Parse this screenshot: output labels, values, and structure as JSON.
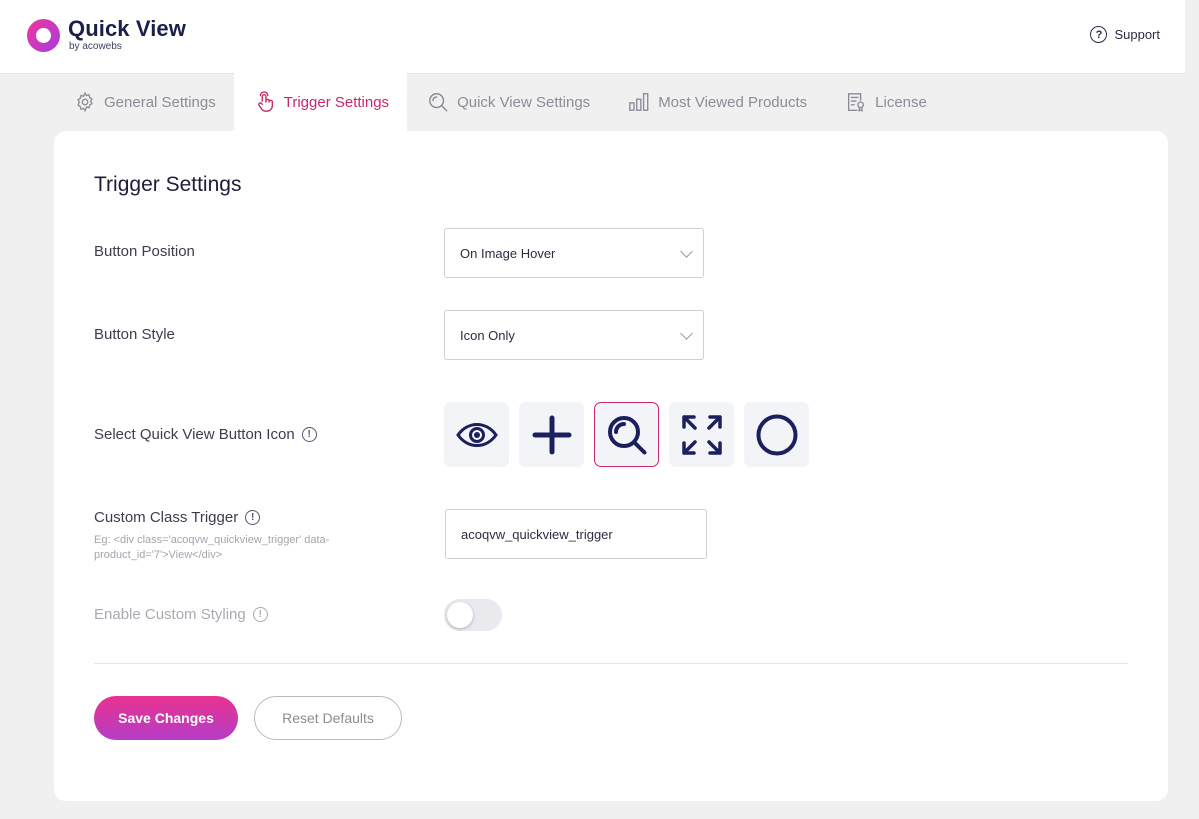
{
  "header": {
    "logo_title": "Quick View",
    "logo_sub": "by acowebs",
    "support_label": "Support"
  },
  "tabs": [
    {
      "label": "General Settings",
      "icon": "gear-icon",
      "active": false
    },
    {
      "label": "Trigger Settings",
      "icon": "touch-hand-icon",
      "active": true
    },
    {
      "label": "Quick View Settings",
      "icon": "magnify-icon",
      "active": false
    },
    {
      "label": "Most Viewed Products",
      "icon": "bar-chart-icon",
      "active": false
    },
    {
      "label": "License",
      "icon": "certificate-icon",
      "active": false
    }
  ],
  "panel": {
    "title": "Trigger Settings",
    "button_position": {
      "label": "Button Position",
      "value": "On Image Hover"
    },
    "button_style": {
      "label": "Button Style",
      "value": "Icon Only"
    },
    "icon_select": {
      "label": "Select Quick View Button Icon",
      "options": [
        "eye-icon",
        "plus-icon",
        "magnify-icon",
        "expand-arrows-icon",
        "circle-icon"
      ],
      "selected": "magnify-icon"
    },
    "custom_class": {
      "label": "Custom Class Trigger",
      "hint": "Eg: <div class='acoqvw_quickview_trigger' data-product_id='7'>View</div>",
      "value": "acoqvw_quickview_trigger"
    },
    "custom_styling": {
      "label": "Enable Custom Styling",
      "enabled": false
    },
    "save_label": "Save Changes",
    "reset_label": "Reset Defaults"
  },
  "colors": {
    "accent": "#c7286f",
    "icon_navy": "#1c1f5e",
    "save_gradient_start": "#e8328e",
    "save_gradient_end": "#b53cc8"
  }
}
